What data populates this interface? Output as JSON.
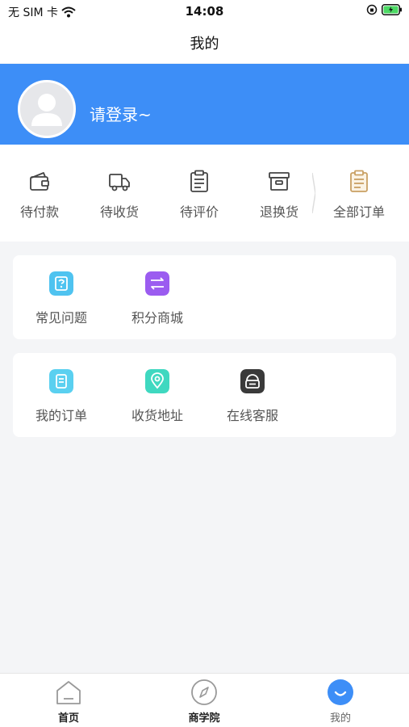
{
  "status_bar": {
    "carrier": "无 SIM 卡",
    "time": "14:08"
  },
  "header": {
    "title": "我的"
  },
  "profile": {
    "login_prompt": "请登录~"
  },
  "orders": [
    {
      "label": "待付款",
      "icon": "wallet-icon"
    },
    {
      "label": "待收货",
      "icon": "truck-icon"
    },
    {
      "label": "待评价",
      "icon": "clipboard-icon"
    },
    {
      "label": "退换货",
      "icon": "return-box-icon"
    },
    {
      "label": "全部订单",
      "icon": "all-orders-icon"
    }
  ],
  "services_group_1": [
    {
      "label": "常见问题",
      "icon": "faq-icon",
      "color": "#4fc3f0"
    },
    {
      "label": "积分商城",
      "icon": "points-exchange-icon",
      "color": "#9b5cf0"
    }
  ],
  "services_group_2": [
    {
      "label": "我的订单",
      "icon": "my-order-icon",
      "color": "#5ad0f0"
    },
    {
      "label": "收货地址",
      "icon": "location-icon",
      "color": "#3fd8c0"
    },
    {
      "label": "在线客服",
      "icon": "customer-service-icon",
      "color": "#3a3a3a"
    }
  ],
  "tab_bar": [
    {
      "label": "首页",
      "icon": "home-icon"
    },
    {
      "label": "商学院",
      "icon": "compass-icon"
    },
    {
      "label": "我的",
      "icon": "profile-smile-icon",
      "active": true
    }
  ],
  "colors": {
    "brand_blue": "#3d8ef7",
    "background": "#f4f5f7",
    "all_orders_accent": "#c9a063"
  }
}
